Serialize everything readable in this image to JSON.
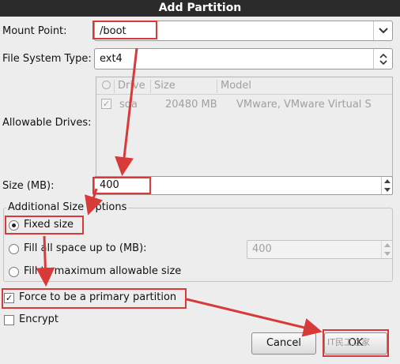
{
  "window": {
    "title": "Add Partition"
  },
  "mount_point": {
    "label": "Mount Point:",
    "value": "/boot",
    "button_icon": "chevron-down-icon"
  },
  "fs_type": {
    "label": "File System Type:",
    "value": "ext4",
    "button_icon": "updown-icon"
  },
  "drives": {
    "label": "Allowable Drives:",
    "columns": [
      "Drive",
      "Size",
      "Model"
    ],
    "rows": [
      {
        "checked": true,
        "drive": "sda",
        "size": "20480 MB",
        "model": "VMware, VMware Virtual S"
      }
    ]
  },
  "size": {
    "label": "Size (MB):",
    "value": "400"
  },
  "size_options": {
    "title": "Additional Size Options",
    "fixed": "Fixed size",
    "fill_up_to": "Fill all space up to (MB):",
    "fill_up_to_value": "400",
    "fill_max": "Fill to maximum allowable size",
    "selected": "fixed"
  },
  "primary": {
    "label": "Force to be a primary partition",
    "checked": true
  },
  "encrypt": {
    "label": "Encrypt",
    "checked": false
  },
  "buttons": {
    "cancel": "Cancel",
    "ok": "OK"
  },
  "watermark": "IT民工之家",
  "colors": {
    "annotation": "#d83a3a",
    "titlebar": "#2b2b2b"
  }
}
